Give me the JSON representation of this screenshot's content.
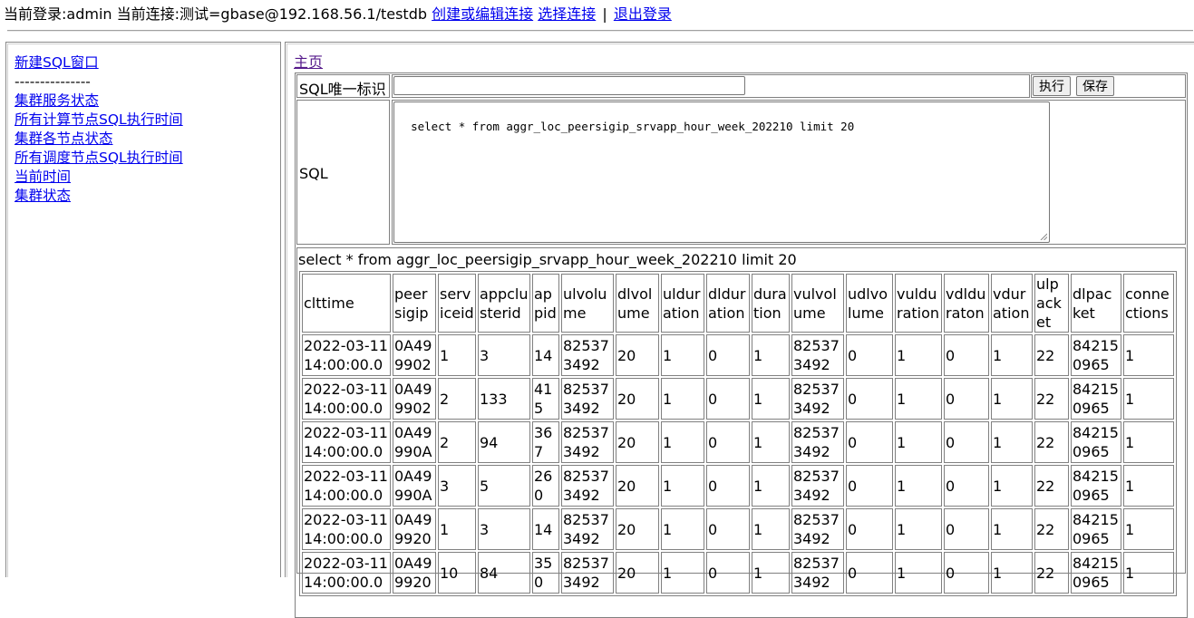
{
  "topbar": {
    "status_text": "当前登录:admin 当前连接:测试=gbase@192.168.56.1/testdb",
    "create_edit_link": "创建或编辑连接",
    "select_link": "选择连接",
    "separator": "|",
    "logout_link": "退出登录"
  },
  "sidebar": {
    "new_window": "新建SQL窗口",
    "divider": "---------------",
    "items": [
      "集群服务状态",
      "所有计算节点SQL执行时间",
      "集群各节点状态",
      "所有调度节点SQL执行时间",
      "当前时间",
      "集群状态"
    ]
  },
  "main": {
    "home_link": "主页",
    "sql_id_label": "SQL唯一标识",
    "sql_id_value": "",
    "execute_button": "执行",
    "save_button": "保存",
    "sql_label": "SQL",
    "sql_text": "select * from aggr_loc_peersigip_srvapp_hour_week_202210 limit 20",
    "result_caption": "select * from aggr_loc_peersigip_srvapp_hour_week_202210 limit 20"
  },
  "results": {
    "columns": [
      "clttime",
      "peersigip",
      "serviceid",
      "appclusterid",
      "appid",
      "ulvolume",
      "dlvolume",
      "ulduration",
      "dlduration",
      "duration",
      "vulvolume",
      "udlvolume",
      "vulduration",
      "vdlduraton",
      "vduration",
      "ulpacket",
      "dlpacket",
      "connections"
    ],
    "rows": [
      [
        "2022-03-11 14:00:00.0",
        "0A499902",
        "1",
        "3",
        "14",
        "825373492",
        "20",
        "1",
        "0",
        "1",
        "825373492",
        "0",
        "1",
        "0",
        "1",
        "22",
        "842150965",
        "1"
      ],
      [
        "2022-03-11 14:00:00.0",
        "0A499902",
        "2",
        "133",
        "415",
        "825373492",
        "20",
        "1",
        "0",
        "1",
        "825373492",
        "0",
        "1",
        "0",
        "1",
        "22",
        "842150965",
        "1"
      ],
      [
        "2022-03-11 14:00:00.0",
        "0A49990A",
        "2",
        "94",
        "367",
        "825373492",
        "20",
        "1",
        "0",
        "1",
        "825373492",
        "0",
        "1",
        "0",
        "1",
        "22",
        "842150965",
        "1"
      ],
      [
        "2022-03-11 14:00:00.0",
        "0A49990A",
        "3",
        "5",
        "260",
        "825373492",
        "20",
        "1",
        "0",
        "1",
        "825373492",
        "0",
        "1",
        "0",
        "1",
        "22",
        "842150965",
        "1"
      ],
      [
        "2022-03-11 14:00:00.0",
        "0A499920",
        "1",
        "3",
        "14",
        "825373492",
        "20",
        "1",
        "0",
        "1",
        "825373492",
        "0",
        "1",
        "0",
        "1",
        "22",
        "842150965",
        "1"
      ],
      [
        "2022-03-11 14:00:00.0",
        "0A499920",
        "10",
        "84",
        "350",
        "825373492",
        "20",
        "1",
        "0",
        "1",
        "825373492",
        "0",
        "1",
        "0",
        "1",
        "22",
        "842150965",
        "1"
      ]
    ]
  }
}
